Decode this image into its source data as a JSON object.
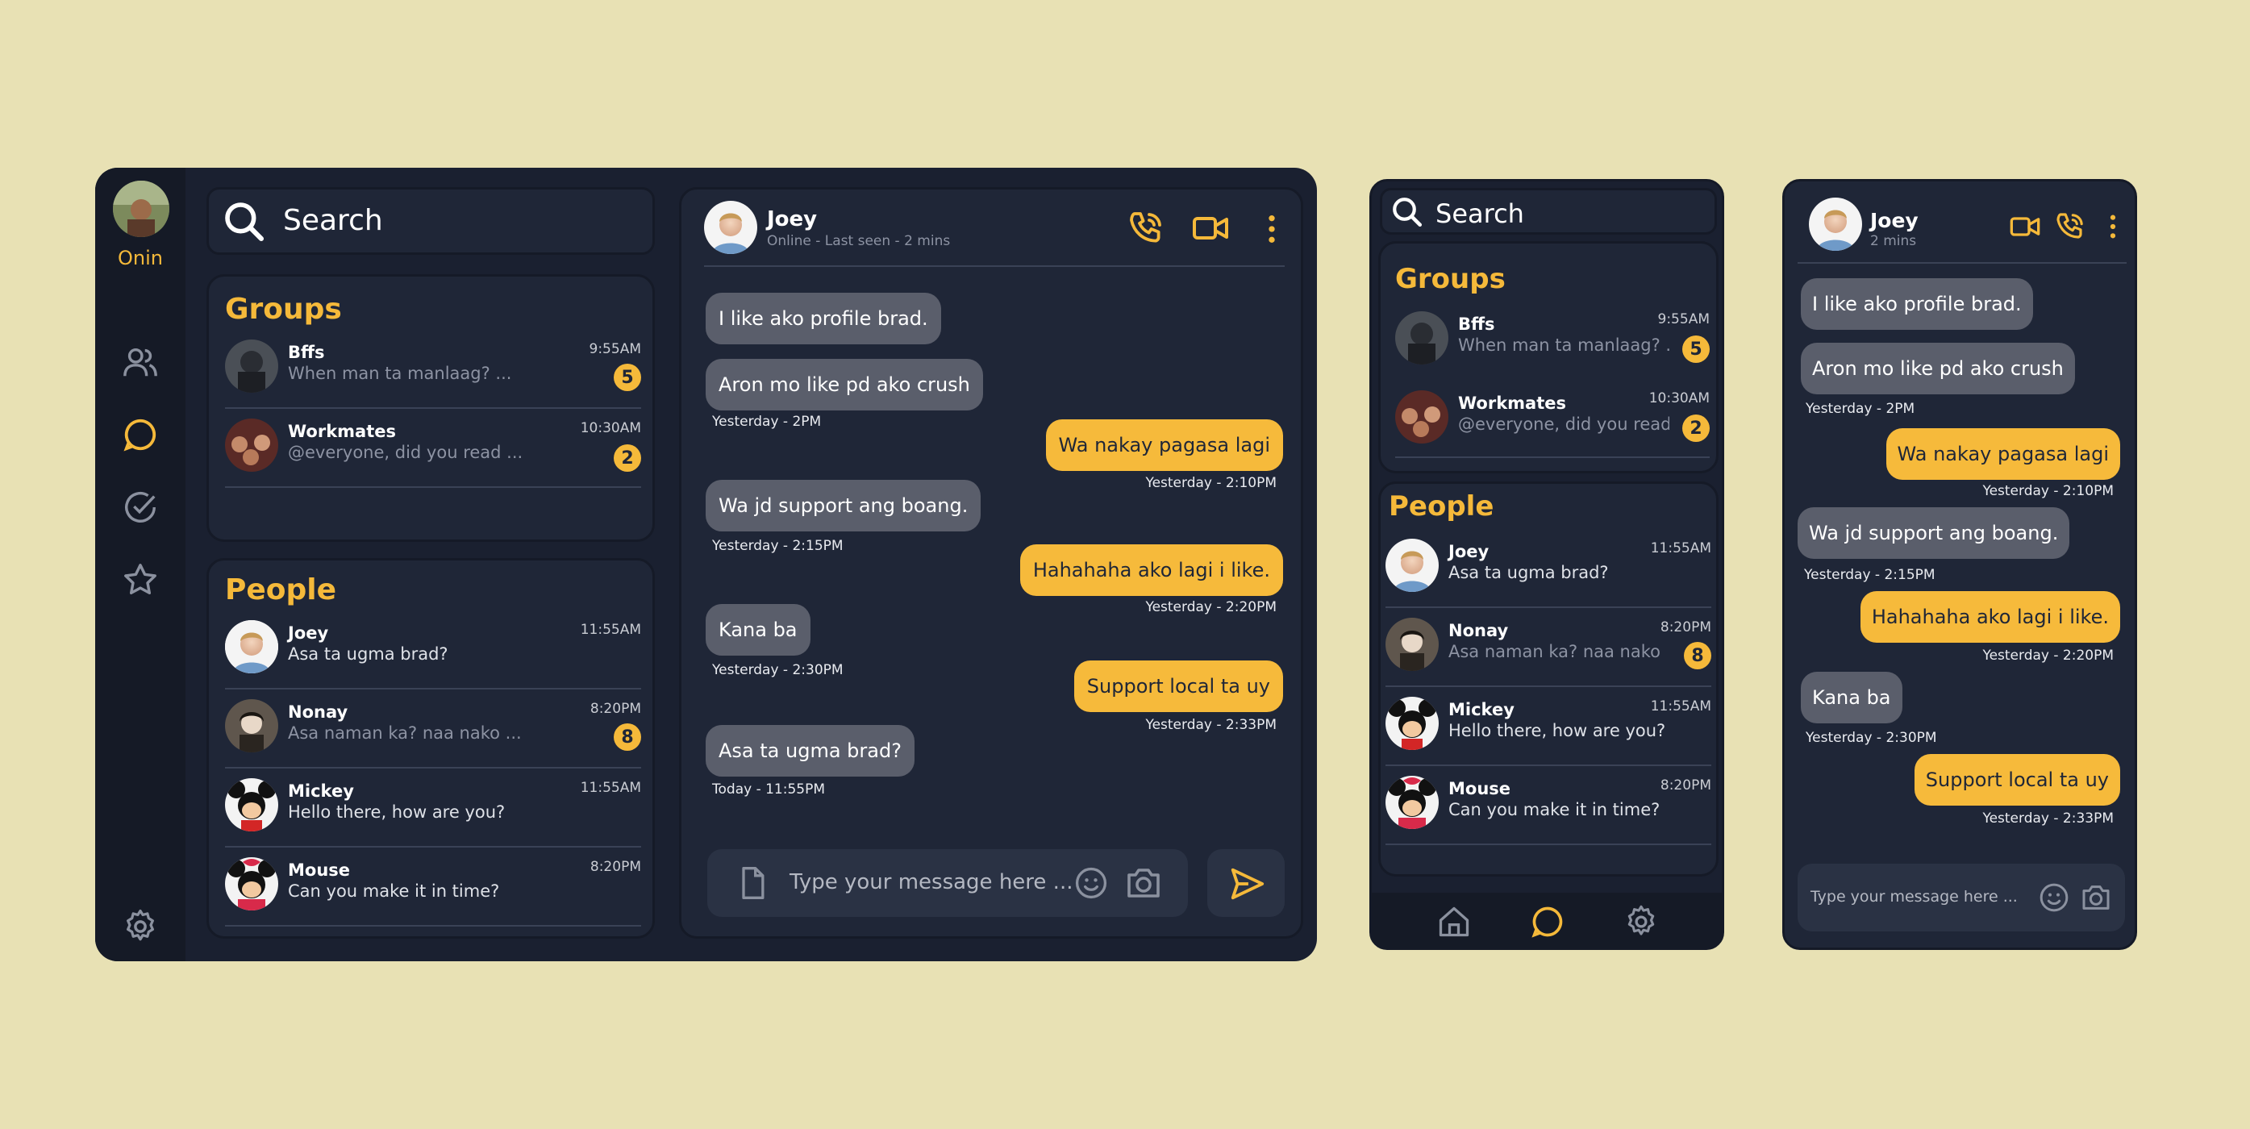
{
  "user": {
    "name": "Onin"
  },
  "search": {
    "placeholder": "Search"
  },
  "groups": {
    "title": "Groups",
    "items": [
      {
        "name": "Bffs",
        "preview": "When man ta manlaag? ...",
        "time": "9:55AM",
        "unread": "5"
      },
      {
        "name": "Workmates",
        "preview": "@everyone, did you read ...",
        "time": "10:30AM",
        "unread": "2"
      }
    ]
  },
  "people": {
    "title": "People",
    "items": [
      {
        "name": "Joey",
        "preview": "Asa ta ugma brad?",
        "time": "11:55AM",
        "unread": ""
      },
      {
        "name": "Nonay",
        "preview": "Asa naman ka? naa nako ...",
        "time": "8:20PM",
        "unread": "8"
      },
      {
        "name": "Mickey",
        "preview": "Hello there, how are you?",
        "time": "11:55AM",
        "unread": ""
      },
      {
        "name": "Mouse",
        "preview": "Can you make it in time?",
        "time": "8:20PM",
        "unread": ""
      }
    ]
  },
  "tablet": {
    "groups_previews": [
      "When man ta manlaag? ...",
      "@everyone, did you read ..."
    ],
    "people_previews": [
      "Asa ta ugma brad?",
      "Asa naman ka? naa nako ...",
      "Hello there, how are you?",
      "Can you make it in time?"
    ]
  },
  "chat": {
    "contact": "Joey",
    "status": "Online - Last seen - 2 mins",
    "status_short": "2 mins",
    "messages": [
      {
        "dir": "in",
        "text": "I like ako profile brad.",
        "stamp": ""
      },
      {
        "dir": "in",
        "text": "Aron mo like pd ako crush",
        "stamp": "Yesterday - 2PM"
      },
      {
        "dir": "out",
        "text": "Wa nakay pagasa lagi",
        "stamp": "Yesterday - 2:10PM"
      },
      {
        "dir": "in",
        "text": "Wa jd support ang boang.",
        "stamp": "Yesterday - 2:15PM"
      },
      {
        "dir": "out",
        "text": "Hahahaha ako lagi i like.",
        "stamp": "Yesterday - 2:20PM"
      },
      {
        "dir": "in",
        "text": "Kana ba",
        "stamp": "Yesterday - 2:30PM"
      },
      {
        "dir": "out",
        "text": "Support local ta uy",
        "stamp": "Yesterday - 2:33PM"
      },
      {
        "dir": "in",
        "text": "Asa ta ugma brad?",
        "stamp": "Today - 11:55PM"
      }
    ],
    "input_placeholder": "Type your message here ..."
  },
  "colors": {
    "background": "#e8e1b4",
    "panel": "#1f2637",
    "accent": "#f5b93a",
    "incoming": "#5a5e6b"
  },
  "icons": [
    "search-icon",
    "people-icon",
    "chat-icon",
    "check-circle-icon",
    "star-icon",
    "gear-icon",
    "phone-icon",
    "video-icon",
    "more-icon",
    "file-icon",
    "emoji-icon",
    "camera-icon",
    "send-icon",
    "home-icon"
  ]
}
